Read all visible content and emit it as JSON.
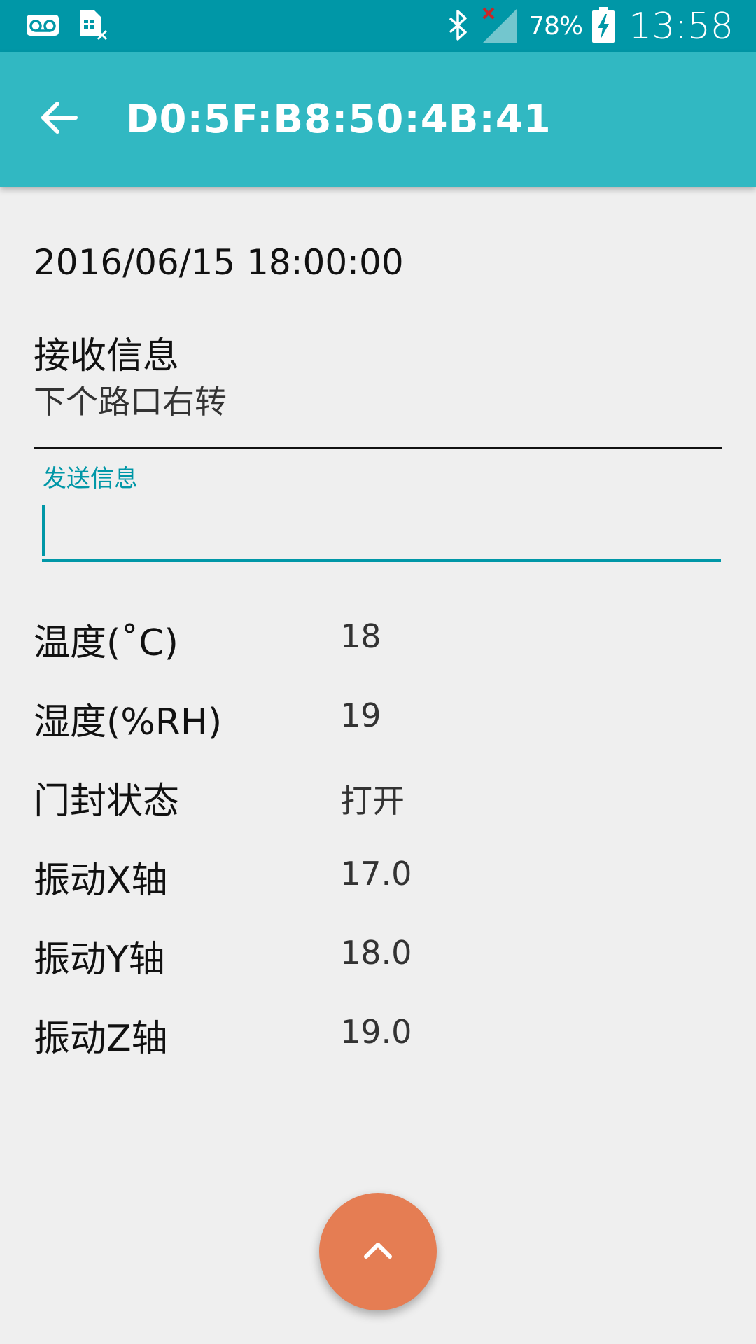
{
  "status_bar": {
    "battery_percent": "78%",
    "time": "13:58",
    "icons": [
      "voicemail-icon",
      "sim-missing-icon",
      "bluetooth-icon",
      "no-signal-icon",
      "battery-charging-icon"
    ]
  },
  "app_bar": {
    "title": "D0:5F:B8:50:4B:41"
  },
  "main": {
    "timestamp": "2016/06/15 18:00:00",
    "receive_label": "接收信息",
    "receive_text": "下个路口右转",
    "send_label": "发送信息",
    "send_value": ""
  },
  "readings": [
    {
      "label": "温度(˚C)",
      "value": "18"
    },
    {
      "label": "湿度(%RH)",
      "value": "19"
    },
    {
      "label": "门封状态",
      "value": "打开"
    },
    {
      "label": "振动X轴",
      "value": "17.0"
    },
    {
      "label": "振动Y轴",
      "value": "18.0"
    },
    {
      "label": "振动Z轴",
      "value": "19.0"
    }
  ],
  "colors": {
    "status_bar": "#0097a7",
    "app_bar": "#31b8c2",
    "accent": "#0097a7",
    "fab": "#e57d53",
    "background": "#efefef"
  },
  "fab": {
    "icon": "chevron-up-icon"
  }
}
